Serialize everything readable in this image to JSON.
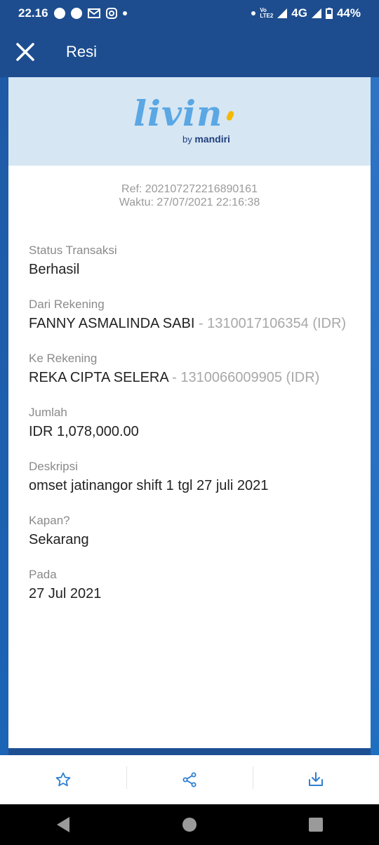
{
  "status_bar": {
    "time": "22.16",
    "volte": "Vo⁠LTE2",
    "network": "4G",
    "battery": "44%"
  },
  "app_bar": {
    "title": "Resi"
  },
  "logo": {
    "text": "livin",
    "by": "by",
    "brand": "mandiri"
  },
  "receipt": {
    "ref": "Ref: 202107272216890161",
    "waktu": "Waktu: 27/07/2021 22:16:38",
    "fields": [
      {
        "label": "Status Transaksi",
        "value": "Berhasil",
        "secondary": ""
      },
      {
        "label": "Dari Rekening",
        "value": "FANNY ASMALINDA SABI",
        "secondary": " - 1310017106354 (IDR)"
      },
      {
        "label": "Ke Rekening",
        "value": "REKA CIPTA SELERA",
        "secondary": " - 1310066009905 (IDR)"
      },
      {
        "label": "Jumlah",
        "value": "IDR 1,078,000.00",
        "secondary": ""
      },
      {
        "label": "Deskripsi",
        "value": "omset jatinangor shift 1 tgl 27 juli 2021",
        "secondary": ""
      },
      {
        "label": "Kapan?",
        "value": "Sekarang",
        "secondary": ""
      },
      {
        "label": "Pada",
        "value": "27 Jul 2021",
        "secondary": ""
      }
    ]
  },
  "bottom_actions": {
    "favorite": "star-icon",
    "share": "share-icon",
    "download": "download-icon"
  },
  "colors": {
    "primary": "#1d4d8f",
    "accent": "#2f7fd0",
    "header_bg": "#d6e6f3",
    "logo_blue": "#5aa7e4",
    "logo_yellow": "#f5b800"
  }
}
